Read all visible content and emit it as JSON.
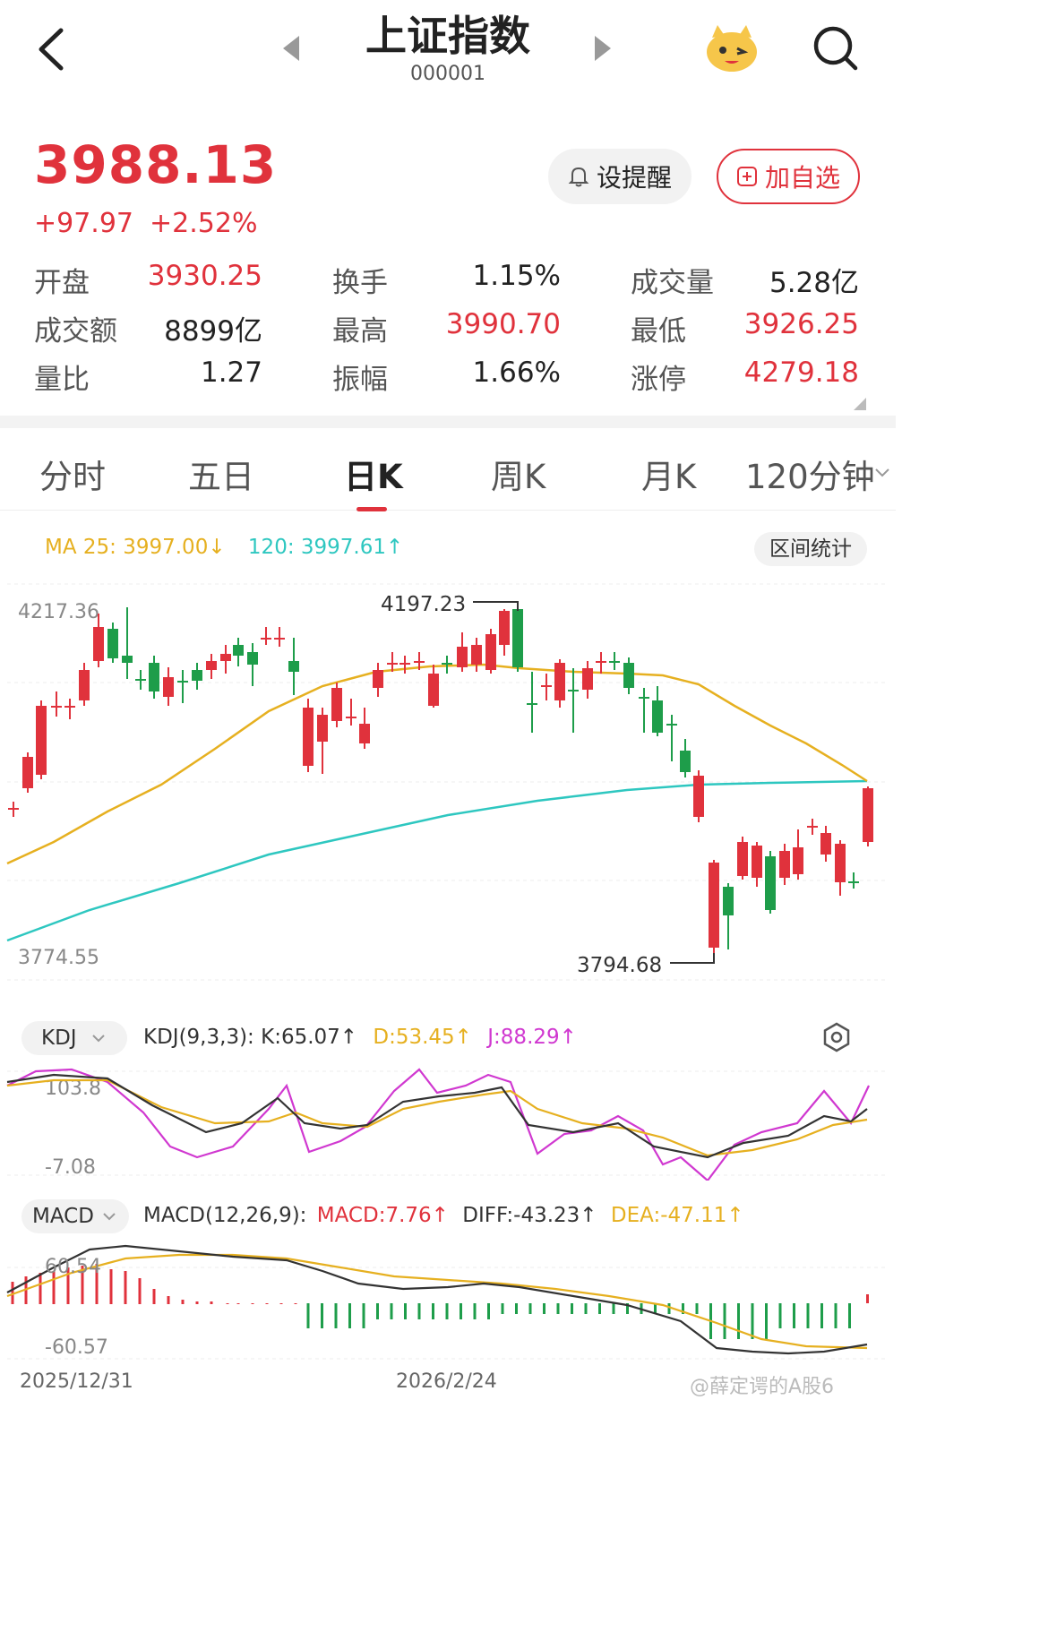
{
  "header": {
    "title": "上证指数",
    "code": "000001"
  },
  "quote": {
    "price": "3988.13",
    "change": "+97.97",
    "change_pct": "+2.52%",
    "remind_label": "设提醒",
    "add_label": "加自选"
  },
  "stats": [
    [
      {
        "k": "开盘",
        "v": "3930.25",
        "c": "red"
      },
      {
        "k": "换手",
        "v": "1.15%",
        "c": "blk"
      },
      {
        "k": "成交量",
        "v": "5.28亿",
        "c": "blk"
      }
    ],
    [
      {
        "k": "成交额",
        "v": "8899亿",
        "c": "blk"
      },
      {
        "k": "最高",
        "v": "3990.70",
        "c": "red"
      },
      {
        "k": "最低",
        "v": "3926.25",
        "c": "red"
      }
    ],
    [
      {
        "k": "量比",
        "v": "1.27",
        "c": "blk"
      },
      {
        "k": "振幅",
        "v": "1.66%",
        "c": "blk"
      },
      {
        "k": "涨停",
        "v": "4279.18",
        "c": "red"
      }
    ]
  ],
  "tabs": [
    "分时",
    "五日",
    "日K",
    "周K",
    "月K",
    "120分钟"
  ],
  "active_tab": "日K",
  "ma_legend": {
    "ma25": "MA 25: 3997.00↓",
    "ma120": "120: 3997.61↑",
    "range_button": "区间统计"
  },
  "kchart": {
    "ylabel_top": "4217.36",
    "ylabel_bottom": "3774.55",
    "high_label": "4197.23",
    "low_label": "3794.68"
  },
  "kdj": {
    "label": "KDJ",
    "params": "KDJ(9,3,3):",
    "k": "K:65.07↑",
    "d": "D:53.45↑",
    "j": "J:88.29↑",
    "ytop": "103.8",
    "ybottom": "-7.08"
  },
  "macd": {
    "label": "MACD",
    "params": "MACD(12,26,9):",
    "macd": "MACD:7.76↑",
    "diff": "DIFF:-43.23↑",
    "dea": "DEA:-47.11↑",
    "ytop": "60.54",
    "ybottom": "-60.57"
  },
  "xaxis": {
    "start": "2025/12/31",
    "mid": "2026/2/24"
  },
  "watermark": "@薛定谔的A股6",
  "colors": {
    "up": "#e0323c",
    "down": "#1e9d4a",
    "ma25": "#e6b020",
    "ma120": "#2ec7c0",
    "kline": "#333333",
    "dline": "#e6b020",
    "jline": "#d038d0"
  }
}
